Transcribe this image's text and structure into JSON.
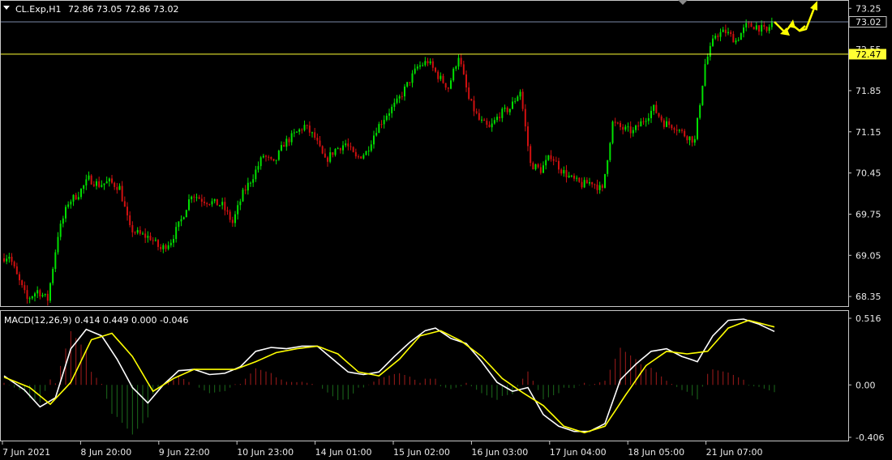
{
  "colors": {
    "background": "#000000",
    "frame": "#c8c8c8",
    "bull": "#00e000",
    "bear": "#d01010",
    "level_line": "#ffff33",
    "price_line": "#7a8aa8",
    "macd_line": "#ffffff",
    "signal_line": "#ffff00",
    "hist_pos": "#a21c1c",
    "hist_neg": "#1c6b1c",
    "arrow": "#ffff00"
  },
  "header": {
    "symbol_period": "CL.Exp,H1",
    "ohlc": "72.86 73.05 72.86 73.02",
    "menu_icon": "triangle-down-icon"
  },
  "price_panel": {
    "current_price_tag": "73.02",
    "level_tag": "72.47",
    "level_price": 72.47,
    "current_price": 73.02,
    "y_ticks": [
      "73.25",
      "72.55",
      "71.85",
      "71.15",
      "70.45",
      "69.75",
      "69.05",
      "68.35"
    ],
    "scroll_marker_icon": "chart-shift-marker-icon"
  },
  "macd_panel": {
    "label": "MACD(12,26,9) 0.414 0.449 0.000 -0.046",
    "y_ticks": [
      "0.516",
      "0.00",
      "-0.406"
    ]
  },
  "time_axis": {
    "labels": [
      "7 Jun 2021",
      "8 Jun 20:00",
      "9 Jun 22:00",
      "10 Jun 23:00",
      "14 Jun 01:00",
      "15 Jun 02:00",
      "16 Jun 03:00",
      "17 Jun 04:00",
      "18 Jun 05:00",
      "21 Jun 07:00"
    ]
  },
  "chart_data": {
    "type": "candlestick",
    "symbol": "CL.Exp",
    "timeframe": "H1",
    "ylim": [
      68.2,
      73.35
    ],
    "price_path": [
      [
        0,
        69.0
      ],
      [
        3,
        69.05
      ],
      [
        6,
        68.7
      ],
      [
        10,
        68.3
      ],
      [
        14,
        68.45
      ],
      [
        18,
        68.3
      ],
      [
        22,
        69.4
      ],
      [
        26,
        69.95
      ],
      [
        30,
        70.1
      ],
      [
        34,
        70.35
      ],
      [
        38,
        70.25
      ],
      [
        42,
        70.3
      ],
      [
        46,
        70.2
      ],
      [
        50,
        69.5
      ],
      [
        54,
        69.4
      ],
      [
        58,
        69.35
      ],
      [
        62,
        69.15
      ],
      [
        66,
        69.3
      ],
      [
        70,
        69.65
      ],
      [
        74,
        70.1
      ],
      [
        78,
        70.0
      ],
      [
        82,
        69.95
      ],
      [
        86,
        69.9
      ],
      [
        90,
        69.6
      ],
      [
        94,
        70.1
      ],
      [
        98,
        70.4
      ],
      [
        102,
        70.75
      ],
      [
        106,
        70.6
      ],
      [
        110,
        70.95
      ],
      [
        114,
        71.1
      ],
      [
        118,
        71.25
      ],
      [
        122,
        71.05
      ],
      [
        126,
        70.65
      ],
      [
        130,
        70.85
      ],
      [
        134,
        70.95
      ],
      [
        138,
        70.7
      ],
      [
        142,
        70.8
      ],
      [
        146,
        71.2
      ],
      [
        150,
        71.45
      ],
      [
        154,
        71.65
      ],
      [
        158,
        71.95
      ],
      [
        162,
        72.25
      ],
      [
        166,
        72.35
      ],
      [
        170,
        72.1
      ],
      [
        174,
        71.9
      ],
      [
        178,
        72.45
      ],
      [
        182,
        71.7
      ],
      [
        186,
        71.35
      ],
      [
        190,
        71.2
      ],
      [
        194,
        71.45
      ],
      [
        198,
        71.55
      ],
      [
        202,
        71.85
      ],
      [
        206,
        70.6
      ],
      [
        210,
        70.5
      ],
      [
        214,
        70.75
      ],
      [
        218,
        70.5
      ],
      [
        222,
        70.35
      ],
      [
        226,
        70.25
      ],
      [
        230,
        70.3
      ],
      [
        234,
        70.15
      ],
      [
        238,
        71.3
      ],
      [
        242,
        71.2
      ],
      [
        246,
        71.15
      ],
      [
        250,
        71.35
      ],
      [
        254,
        71.55
      ],
      [
        258,
        71.3
      ],
      [
        262,
        71.25
      ],
      [
        266,
        71.1
      ],
      [
        270,
        71.0
      ],
      [
        274,
        72.3
      ],
      [
        278,
        72.8
      ],
      [
        282,
        72.85
      ],
      [
        286,
        72.7
      ],
      [
        290,
        72.95
      ],
      [
        294,
        72.95
      ],
      [
        298,
        72.85
      ],
      [
        300,
        73.02
      ]
    ],
    "macd": {
      "params": "12,26,9",
      "main": 0.414,
      "signal": 0.449,
      "values_shown": [
        0.414,
        0.449,
        0.0,
        -0.046
      ],
      "ylim": [
        -0.406,
        0.516
      ],
      "main_path": [
        [
          0,
          0.07
        ],
        [
          8,
          -0.04
        ],
        [
          14,
          -0.17
        ],
        [
          20,
          -0.1
        ],
        [
          26,
          0.28
        ],
        [
          32,
          0.43
        ],
        [
          38,
          0.38
        ],
        [
          44,
          0.2
        ],
        [
          50,
          -0.02
        ],
        [
          56,
          -0.14
        ],
        [
          62,
          0.0
        ],
        [
          68,
          0.11
        ],
        [
          74,
          0.12
        ],
        [
          80,
          0.08
        ],
        [
          86,
          0.09
        ],
        [
          92,
          0.14
        ],
        [
          98,
          0.26
        ],
        [
          104,
          0.29
        ],
        [
          110,
          0.28
        ],
        [
          116,
          0.3
        ],
        [
          122,
          0.3
        ],
        [
          128,
          0.2
        ],
        [
          134,
          0.1
        ],
        [
          140,
          0.08
        ],
        [
          146,
          0.1
        ],
        [
          152,
          0.22
        ],
        [
          158,
          0.33
        ],
        [
          164,
          0.42
        ],
        [
          168,
          0.44
        ],
        [
          174,
          0.36
        ],
        [
          180,
          0.32
        ],
        [
          186,
          0.18
        ],
        [
          192,
          0.02
        ],
        [
          198,
          -0.05
        ],
        [
          204,
          -0.02
        ],
        [
          210,
          -0.23
        ],
        [
          216,
          -0.32
        ],
        [
          222,
          -0.36
        ],
        [
          228,
          -0.36
        ],
        [
          234,
          -0.3
        ],
        [
          240,
          0.04
        ],
        [
          246,
          0.16
        ],
        [
          252,
          0.26
        ],
        [
          258,
          0.28
        ],
        [
          264,
          0.22
        ],
        [
          270,
          0.18
        ],
        [
          276,
          0.38
        ],
        [
          282,
          0.5
        ],
        [
          288,
          0.51
        ],
        [
          294,
          0.47
        ],
        [
          300,
          0.414
        ]
      ],
      "signal_path": [
        [
          0,
          0.06
        ],
        [
          10,
          -0.02
        ],
        [
          18,
          -0.15
        ],
        [
          26,
          0.02
        ],
        [
          34,
          0.35
        ],
        [
          42,
          0.4
        ],
        [
          50,
          0.22
        ],
        [
          58,
          -0.05
        ],
        [
          66,
          0.05
        ],
        [
          74,
          0.12
        ],
        [
          82,
          0.12
        ],
        [
          90,
          0.12
        ],
        [
          98,
          0.18
        ],
        [
          106,
          0.25
        ],
        [
          114,
          0.28
        ],
        [
          122,
          0.3
        ],
        [
          130,
          0.24
        ],
        [
          138,
          0.1
        ],
        [
          146,
          0.07
        ],
        [
          154,
          0.2
        ],
        [
          162,
          0.38
        ],
        [
          170,
          0.42
        ],
        [
          178,
          0.34
        ],
        [
          186,
          0.22
        ],
        [
          194,
          0.05
        ],
        [
          202,
          -0.06
        ],
        [
          210,
          -0.16
        ],
        [
          218,
          -0.32
        ],
        [
          226,
          -0.37
        ],
        [
          234,
          -0.32
        ],
        [
          242,
          -0.08
        ],
        [
          250,
          0.15
        ],
        [
          258,
          0.26
        ],
        [
          266,
          0.24
        ],
        [
          274,
          0.26
        ],
        [
          282,
          0.44
        ],
        [
          290,
          0.5
        ],
        [
          300,
          0.449
        ]
      ]
    },
    "forecast_arrows_count": 3
  }
}
